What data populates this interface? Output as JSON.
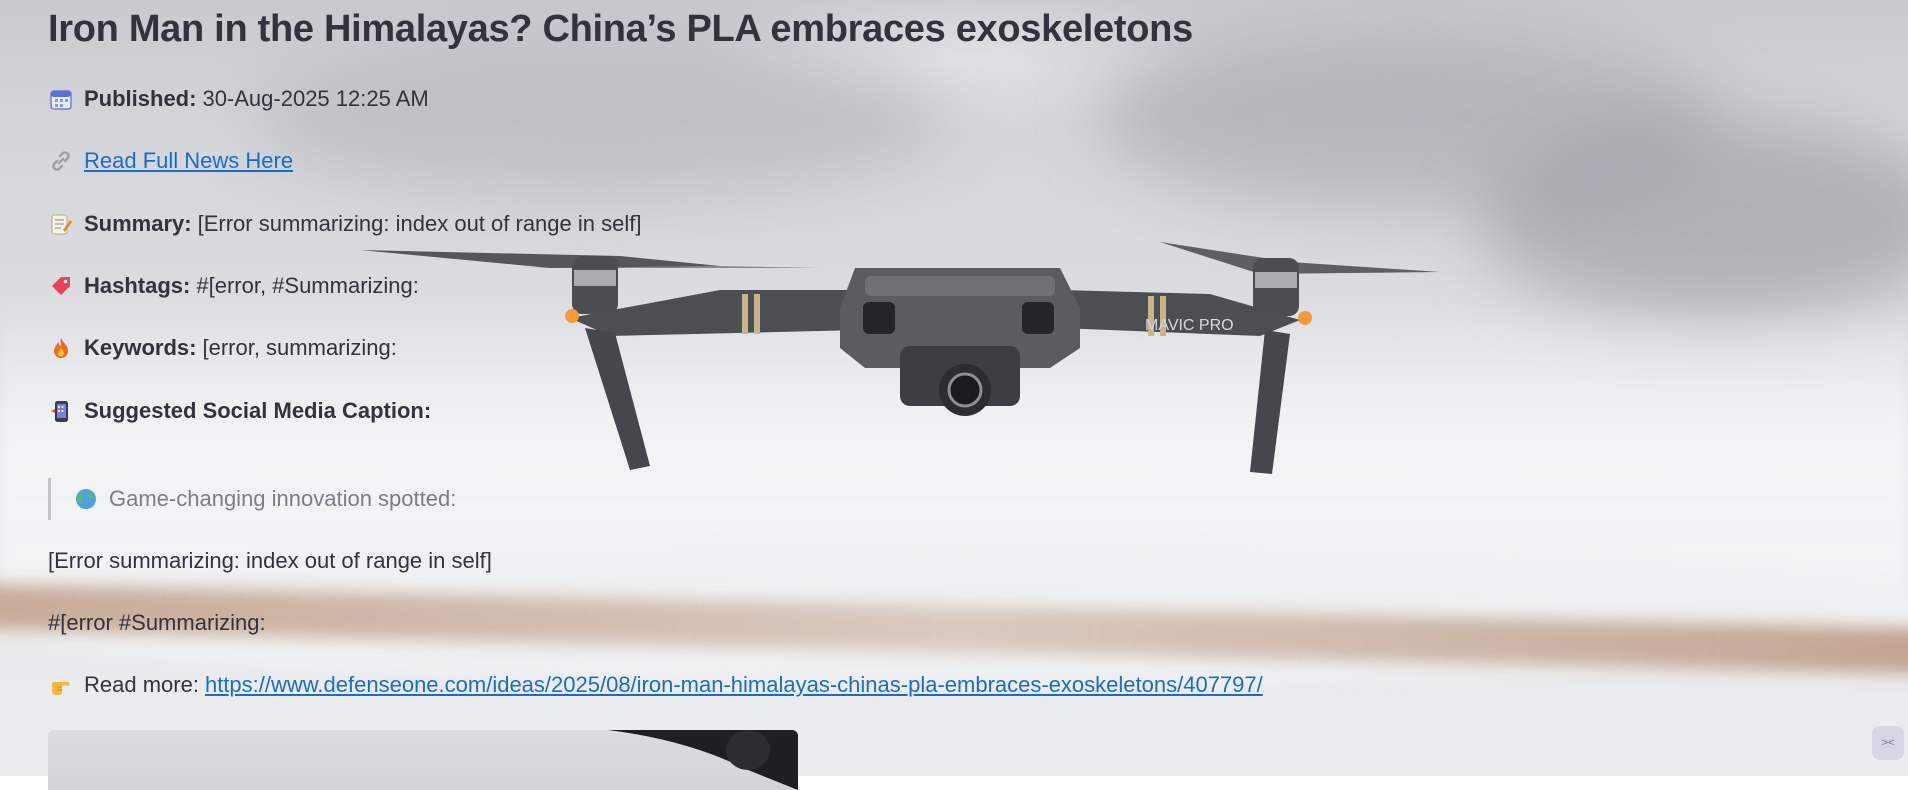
{
  "article": {
    "title": "Iron Man in the Himalayas? China’s PLA embraces exoskeletons",
    "published_label": "Published:",
    "published_value": "30-Aug-2025 12:25 AM",
    "read_full_link": "Read Full News Here",
    "summary_label": "Summary:",
    "summary_value": "[Error summarizing: index out of range in self]",
    "hashtags_label": "Hashtags:",
    "hashtags_value": "#[error, #Summarizing:",
    "keywords_label": "Keywords:",
    "keywords_value": "[error, summarizing:",
    "caption_label": "Suggested Social Media Caption:"
  },
  "caption": {
    "quote_text": "Game-changing innovation spotted:",
    "summary_line": "[Error summarizing: index out of range in self]",
    "hashtag_line": "#[error #Summarizing:",
    "read_more_label": "Read more:",
    "read_more_url": "https://www.defenseone.com/ideas/2025/08/iron-man-himalayas-chinas-pla-embraces-exoskeletons/407797/"
  },
  "drone": {
    "branding": "MAVIC PRO"
  },
  "corner_widget": {
    "label": "><"
  },
  "colors": {
    "link": "#1a6bd1",
    "text": "#31333f"
  },
  "icons": [
    "calendar-icon",
    "link-icon",
    "memo-icon",
    "tag-icon",
    "fire-icon",
    "mobile-phone-icon",
    "globe-icon",
    "pointing-hand-icon"
  ]
}
